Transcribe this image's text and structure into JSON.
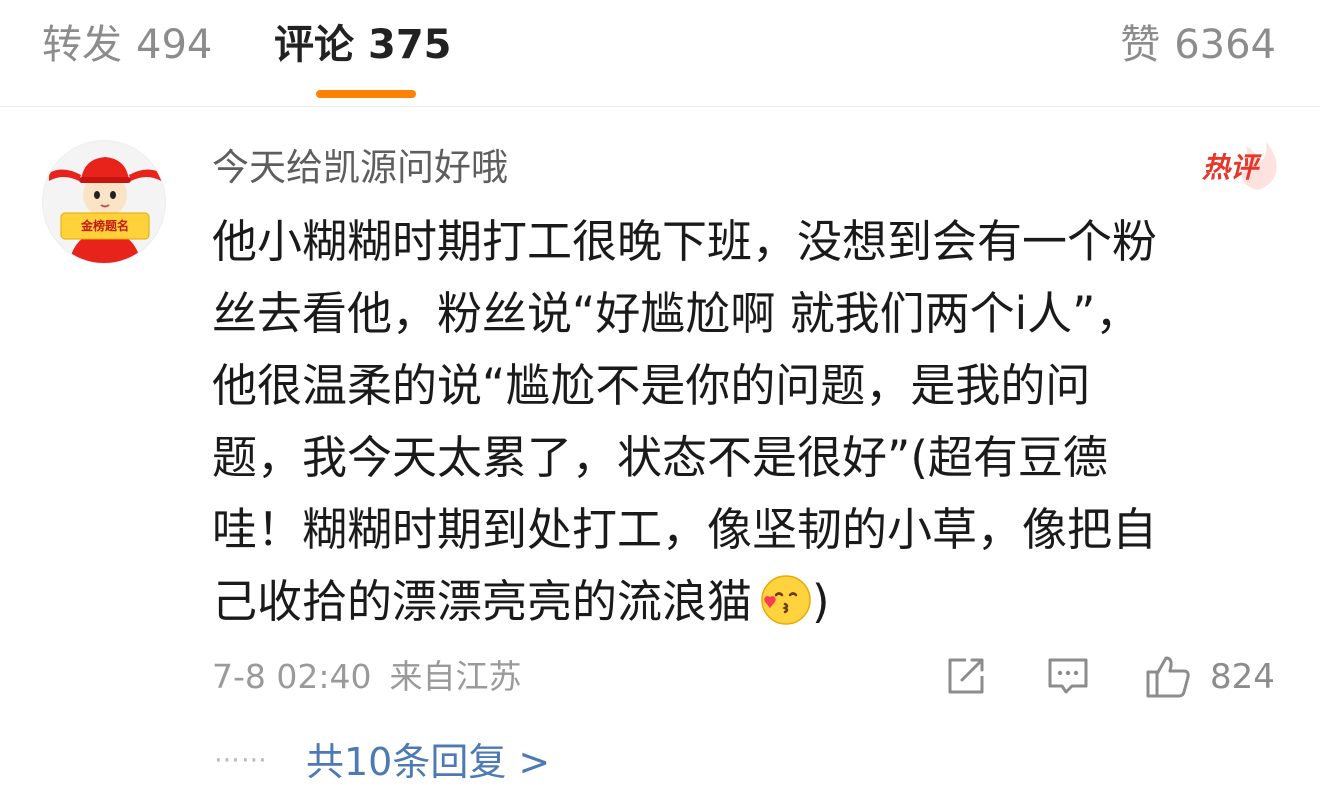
{
  "tabs": {
    "repost": {
      "label": "转发",
      "count": "494"
    },
    "comment": {
      "label": "评论",
      "count": "375"
    },
    "like": {
      "label": "赞",
      "count": "6364"
    }
  },
  "colors": {
    "accent": "#ff8200",
    "hot_badge": "#e8362a",
    "link": "#4d79b5"
  },
  "comment": {
    "avatar_icon": "avatar-icon",
    "avatar_banner_text": "金榜题名",
    "username": "今天给凯源问好哦",
    "hot_badge": "热评",
    "text_lines": [
      "他小糊糊时期打工很晚下班，没想到会有一个粉",
      "丝去看他，粉丝说“好尴尬啊 就我们两个i人”，",
      "他很温柔的说“尴尬不是你的问题，是我的问",
      "题，我今天太累了，状态不是很好”(超有豆德",
      "哇！糊糊时期到处打工，像坚韧的小草，像把自",
      "己收拾的漂漂亮亮的流浪猫"
    ],
    "text_end": ")",
    "emoji_icon": "kissing-heart-emoji-icon",
    "time": "7-8 02:40",
    "location": "来自江苏",
    "like_count": "824",
    "replies_dots": "⋯⋯",
    "replies_link": "共10条回复 >"
  }
}
